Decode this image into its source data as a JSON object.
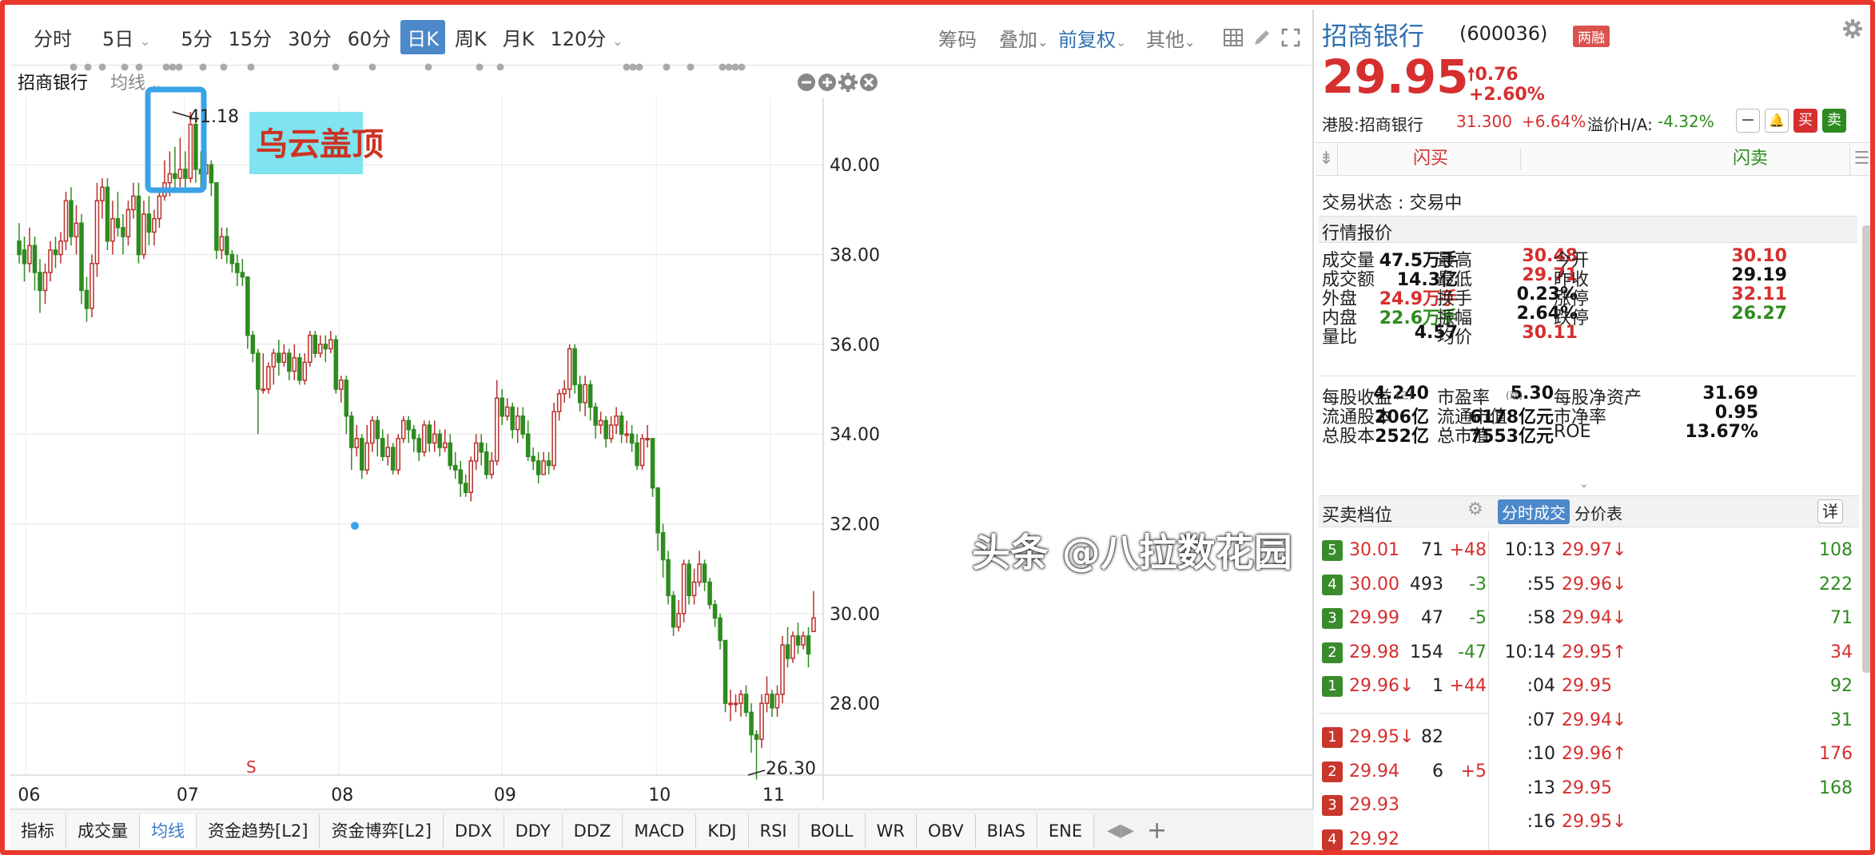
{
  "toolbar": {
    "timeframes": [
      "分时",
      "5日",
      "5分",
      "15分",
      "30分",
      "60分",
      "日K",
      "周K",
      "月K",
      "120分"
    ],
    "active": "日K",
    "right": {
      "chips": "筹码",
      "overlay": "叠加",
      "adjust": "前复权",
      "other": "其他"
    }
  },
  "subbar": {
    "name": "招商银行",
    "indicator": "均线"
  },
  "annotation": {
    "label": "乌云盖顶",
    "high_label": "41.18",
    "low_label": "26.30",
    "signal": "S"
  },
  "chart_data": {
    "type": "candlestick",
    "ylim": [
      26.4,
      41.5
    ],
    "yticks": [
      "40.00",
      "38.00",
      "36.00",
      "34.00",
      "32.00",
      "30.00",
      "28.00"
    ],
    "xticks": [
      "06",
      "07",
      "08",
      "09",
      "10",
      "11"
    ],
    "candles": [
      [
        38.3,
        38.0,
        38.7,
        37.8
      ],
      [
        38.1,
        37.8,
        38.4,
        37.4
      ],
      [
        37.8,
        38.2,
        38.6,
        37.6
      ],
      [
        38.2,
        37.6,
        38.4,
        37.2
      ],
      [
        37.6,
        37.2,
        37.9,
        36.7
      ],
      [
        37.2,
        37.6,
        37.8,
        36.9
      ],
      [
        37.6,
        38.1,
        38.3,
        37.4
      ],
      [
        38.1,
        38.0,
        38.4,
        37.7
      ],
      [
        38.0,
        38.3,
        38.5,
        37.8
      ],
      [
        38.3,
        39.2,
        39.4,
        38.1
      ],
      [
        39.2,
        38.4,
        39.5,
        38.2
      ],
      [
        38.4,
        38.7,
        39.1,
        38.0
      ],
      [
        38.7,
        37.2,
        38.9,
        36.9
      ],
      [
        37.2,
        36.8,
        37.5,
        36.5
      ],
      [
        36.8,
        37.8,
        38.0,
        36.6
      ],
      [
        37.8,
        39.2,
        39.6,
        37.5
      ],
      [
        39.2,
        39.5,
        39.7,
        38.8
      ],
      [
        39.5,
        38.3,
        39.7,
        38.1
      ],
      [
        38.3,
        38.8,
        39.2,
        38.0
      ],
      [
        38.8,
        38.6,
        39.4,
        38.4
      ],
      [
        38.6,
        38.4,
        38.9,
        38.0
      ],
      [
        38.4,
        39.0,
        39.2,
        38.2
      ],
      [
        39.0,
        39.3,
        39.6,
        38.8
      ],
      [
        39.3,
        38.0,
        39.6,
        37.8
      ],
      [
        38.0,
        38.9,
        39.2,
        37.9
      ],
      [
        38.9,
        38.5,
        39.3,
        38.2
      ],
      [
        38.5,
        38.8,
        39.0,
        38.2
      ],
      [
        38.8,
        39.3,
        39.5,
        38.6
      ],
      [
        39.3,
        39.6,
        40.1,
        39.2
      ],
      [
        39.6,
        39.8,
        40.3,
        39.3
      ],
      [
        39.8,
        39.7,
        40.4,
        39.4
      ],
      [
        39.7,
        39.9,
        40.6,
        39.5
      ],
      [
        39.9,
        39.7,
        40.3,
        39.4
      ],
      [
        39.7,
        40.9,
        41.18,
        39.6
      ],
      [
        40.9,
        39.9,
        41.0,
        39.6
      ],
      [
        39.9,
        39.8,
        40.3,
        39.5
      ],
      [
        39.8,
        40.0,
        40.3,
        39.6
      ],
      [
        40.0,
        39.6,
        40.1,
        39.3
      ],
      [
        39.6,
        38.1,
        39.6,
        37.9
      ],
      [
        38.1,
        38.4,
        38.6,
        37.9
      ],
      [
        38.4,
        38.0,
        38.6,
        37.8
      ],
      [
        38.0,
        37.8,
        38.1,
        37.6
      ],
      [
        37.8,
        37.6,
        38.0,
        37.3
      ],
      [
        37.6,
        37.5,
        37.9,
        37.3
      ],
      [
        37.5,
        36.2,
        37.5,
        35.9
      ],
      [
        36.2,
        35.8,
        36.3,
        35.6
      ],
      [
        35.8,
        35.0,
        35.9,
        34.0
      ],
      [
        35.0,
        35.0,
        35.8,
        34.9
      ],
      [
        35.0,
        35.5,
        35.6,
        34.9
      ],
      [
        35.5,
        35.8,
        35.9,
        35.1
      ],
      [
        35.8,
        35.6,
        36.1,
        35.3
      ],
      [
        35.6,
        35.8,
        36.0,
        35.5
      ],
      [
        35.8,
        35.4,
        35.9,
        35.2
      ],
      [
        35.4,
        35.7,
        36.0,
        35.2
      ],
      [
        35.7,
        35.2,
        35.8,
        35.1
      ],
      [
        35.2,
        35.6,
        35.8,
        35.1
      ],
      [
        35.6,
        36.2,
        36.3,
        35.5
      ],
      [
        36.2,
        35.8,
        36.3,
        35.7
      ],
      [
        35.8,
        36.0,
        36.2,
        35.7
      ],
      [
        36.0,
        35.9,
        36.2,
        35.6
      ],
      [
        35.9,
        36.1,
        36.3,
        35.8
      ],
      [
        36.1,
        35.0,
        36.2,
        34.9
      ],
      [
        35.0,
        35.2,
        35.3,
        34.7
      ],
      [
        35.2,
        34.4,
        35.3,
        34.0
      ],
      [
        34.4,
        33.7,
        34.5,
        33.2
      ],
      [
        33.7,
        33.9,
        34.2,
        33.5
      ],
      [
        33.9,
        33.2,
        34.0,
        33.0
      ],
      [
        33.2,
        33.8,
        34.2,
        33.1
      ],
      [
        33.8,
        34.3,
        34.4,
        33.6
      ],
      [
        34.3,
        33.9,
        34.4,
        33.5
      ],
      [
        33.9,
        33.5,
        34.1,
        33.4
      ],
      [
        33.5,
        33.7,
        34.0,
        33.3
      ],
      [
        33.7,
        33.2,
        33.8,
        33.1
      ],
      [
        33.2,
        33.9,
        34.0,
        33.1
      ],
      [
        33.9,
        34.3,
        34.4,
        33.8
      ],
      [
        34.3,
        34.1,
        34.4,
        33.8
      ],
      [
        34.1,
        33.9,
        34.2,
        33.6
      ],
      [
        33.9,
        33.6,
        34.0,
        33.4
      ],
      [
        33.6,
        34.2,
        34.3,
        33.5
      ],
      [
        34.2,
        33.8,
        34.3,
        33.6
      ],
      [
        33.8,
        34.0,
        34.3,
        33.6
      ],
      [
        34.0,
        33.7,
        34.1,
        33.5
      ],
      [
        33.7,
        33.8,
        34.1,
        33.6
      ],
      [
        33.8,
        33.3,
        34.0,
        33.2
      ],
      [
        33.3,
        33.2,
        33.6,
        33.0
      ],
      [
        33.2,
        32.9,
        33.4,
        32.6
      ],
      [
        32.9,
        32.7,
        33.1,
        32.6
      ],
      [
        32.7,
        33.4,
        33.5,
        32.5
      ],
      [
        33.4,
        33.8,
        34.0,
        33.2
      ],
      [
        33.8,
        33.6,
        34.0,
        33.3
      ],
      [
        33.6,
        33.1,
        33.8,
        33.0
      ],
      [
        33.1,
        33.4,
        33.6,
        33.0
      ],
      [
        33.4,
        34.8,
        35.2,
        33.3
      ],
      [
        34.8,
        34.4,
        35.0,
        34.2
      ],
      [
        34.4,
        34.6,
        34.8,
        34.3
      ],
      [
        34.6,
        34.1,
        34.7,
        33.9
      ],
      [
        34.1,
        34.4,
        34.6,
        33.8
      ],
      [
        34.4,
        34.0,
        34.6,
        33.9
      ],
      [
        34.0,
        33.5,
        34.3,
        33.4
      ],
      [
        33.5,
        33.4,
        33.7,
        33.2
      ],
      [
        33.4,
        33.1,
        33.6,
        32.9
      ],
      [
        33.1,
        33.4,
        33.6,
        33.1
      ],
      [
        33.4,
        33.3,
        33.6,
        33.1
      ],
      [
        33.3,
        34.5,
        34.7,
        33.2
      ],
      [
        34.5,
        34.9,
        35.0,
        34.3
      ],
      [
        34.9,
        35.0,
        35.2,
        34.7
      ],
      [
        35.0,
        35.9,
        36.0,
        34.8
      ],
      [
        35.9,
        35.1,
        36.0,
        34.9
      ],
      [
        35.1,
        34.7,
        35.3,
        34.5
      ],
      [
        34.7,
        35.1,
        35.3,
        34.4
      ],
      [
        35.1,
        34.6,
        35.2,
        34.3
      ],
      [
        34.6,
        34.2,
        34.7,
        33.9
      ],
      [
        34.2,
        34.3,
        34.5,
        34.0
      ],
      [
        34.3,
        33.9,
        34.4,
        33.7
      ],
      [
        33.9,
        34.2,
        34.4,
        33.8
      ],
      [
        34.2,
        34.4,
        34.6,
        34.0
      ],
      [
        34.4,
        34.0,
        34.5,
        33.8
      ],
      [
        34.0,
        34.0,
        34.3,
        33.8
      ],
      [
        34.0,
        33.8,
        34.2,
        33.6
      ],
      [
        33.8,
        33.3,
        34.0,
        33.2
      ],
      [
        33.3,
        33.9,
        34.0,
        33.2
      ],
      [
        33.9,
        33.9,
        34.2,
        33.7
      ],
      [
        33.9,
        32.8,
        33.9,
        32.6
      ],
      [
        32.8,
        31.8,
        32.8,
        31.4
      ],
      [
        31.8,
        31.2,
        32.0,
        30.8
      ],
      [
        31.2,
        30.4,
        31.4,
        30.2
      ],
      [
        30.4,
        29.7,
        30.5,
        29.5
      ],
      [
        29.7,
        30.0,
        30.3,
        29.6
      ],
      [
        30.0,
        31.1,
        31.2,
        29.8
      ],
      [
        31.1,
        30.4,
        31.2,
        30.2
      ],
      [
        30.4,
        30.7,
        31.0,
        30.2
      ],
      [
        30.7,
        31.1,
        31.4,
        30.6
      ],
      [
        31.1,
        30.7,
        31.2,
        30.5
      ],
      [
        30.7,
        30.2,
        30.8,
        30.1
      ],
      [
        30.2,
        29.9,
        30.3,
        29.7
      ],
      [
        29.9,
        29.4,
        30.0,
        29.2
      ],
      [
        29.4,
        28.0,
        29.4,
        27.8
      ],
      [
        28.0,
        28.0,
        28.3,
        27.6
      ],
      [
        28.0,
        28.0,
        28.2,
        27.8
      ],
      [
        28.0,
        28.2,
        28.3,
        27.7
      ],
      [
        28.2,
        27.8,
        28.4,
        27.7
      ],
      [
        27.8,
        27.3,
        28.0,
        26.9
      ],
      [
        27.3,
        27.2,
        27.4,
        26.3
      ],
      [
        27.2,
        28.0,
        28.2,
        27.0
      ],
      [
        28.0,
        28.2,
        28.6,
        27.8
      ],
      [
        28.2,
        27.9,
        28.3,
        27.7
      ],
      [
        27.9,
        28.2,
        28.4,
        27.7
      ],
      [
        28.2,
        29.3,
        29.5,
        28.0
      ],
      [
        29.3,
        29.0,
        29.7,
        28.8
      ],
      [
        29.0,
        29.5,
        29.6,
        28.9
      ],
      [
        29.5,
        29.3,
        29.8,
        29.1
      ],
      [
        29.3,
        29.5,
        29.6,
        29.2
      ],
      [
        29.5,
        29.1,
        29.7,
        28.8
      ],
      [
        29.6,
        29.9,
        30.5,
        29.7
      ]
    ]
  },
  "bottom_tabs": [
    "指标",
    "成交量",
    "均线",
    "资金趋势[L2]",
    "资金博弈[L2]",
    "DDX",
    "DDY",
    "DDZ",
    "MACD",
    "KDJ",
    "RSI",
    "BOLL",
    "WR",
    "OBV",
    "BIAS",
    "ENE"
  ],
  "bottom_active": "均线",
  "stock": {
    "name": "招商银行",
    "code": "(600036)",
    "tag": "两融",
    "price": "29.95",
    "change": "0.76",
    "pct": "+2.60%",
    "hk_label": "港股:招商银行",
    "hk_price": "31.300",
    "hk_pct": "+6.64%",
    "premium_label": "溢价H/A:",
    "premium": "-4.32%",
    "btn_buy": "买",
    "btn_sell": "卖"
  },
  "flash": {
    "buy": "闪买",
    "sell": "闪卖"
  },
  "trade_status": "交易状态 : 交易中",
  "quote_title": "行情报价",
  "quotes": [
    [
      "成交量",
      "47.5万手",
      "最高",
      "30.48",
      "今开",
      "30.10"
    ],
    [
      "成交额",
      "14.3亿",
      "最低",
      "29.71",
      "昨收",
      "29.19"
    ],
    [
      "外盘",
      "24.9万手",
      "换手",
      "0.23%",
      "涨停",
      "32.11"
    ],
    [
      "内盘",
      "22.6万手",
      "振幅",
      "2.64%",
      "跌停",
      "26.27"
    ],
    [
      "量比",
      "4.57",
      "均价",
      "30.11",
      "",
      ""
    ]
  ],
  "fundamentals": [
    [
      "每股收益",
      "4.240",
      "市盈率",
      "5.30",
      "每股净资产",
      "31.69"
    ],
    [
      "流通股本",
      "206亿",
      "流通市值",
      "6178亿元",
      "市净率",
      "0.95"
    ],
    [
      "总股本",
      "252亿",
      "总市值",
      "7553亿元",
      "ROE",
      "13.67%"
    ]
  ],
  "fund_sub": {
    "eps": "(三)",
    "pe": "(动)"
  },
  "orderbook": {
    "title": "买卖档位",
    "sells": [
      [
        "5",
        "30.01",
        "71",
        "+48"
      ],
      [
        "4",
        "30.00",
        "493",
        "-3"
      ],
      [
        "3",
        "29.99",
        "47",
        "-5"
      ],
      [
        "2",
        "29.98",
        "154",
        "-47"
      ],
      [
        "1",
        "29.96↓",
        "1",
        "+44"
      ]
    ],
    "buys": [
      [
        "1",
        "29.95↓",
        "82",
        ""
      ],
      [
        "2",
        "29.94",
        "6",
        "+5"
      ],
      [
        "3",
        "29.93",
        "",
        ""
      ],
      [
        "4",
        "29.92",
        "",
        ""
      ]
    ]
  },
  "ticks": {
    "tab_active": "分时成交",
    "tab2": "分价表",
    "detail": "详",
    "rows": [
      [
        "10:13",
        "29.97↓",
        "108"
      ],
      [
        ":55",
        "29.96↓",
        "222"
      ],
      [
        ":58",
        "29.94↓",
        "71"
      ],
      [
        "10:14",
        "29.95↑",
        "34"
      ],
      [
        ":04",
        "29.95",
        "92"
      ],
      [
        ":07",
        "29.94↓",
        "31"
      ],
      [
        ":10",
        "29.96↑",
        "176"
      ],
      [
        ":13",
        "29.95",
        "168"
      ],
      [
        ":16",
        "29.95↓",
        ""
      ]
    ]
  },
  "watermark": "头条 @八拉数花园",
  "colors": {
    "up": "#d62f2f",
    "down": "#2e8b1f",
    "accent": "#4d88c9",
    "frame": "#e8382b",
    "highlight": "#3aa3e8"
  }
}
